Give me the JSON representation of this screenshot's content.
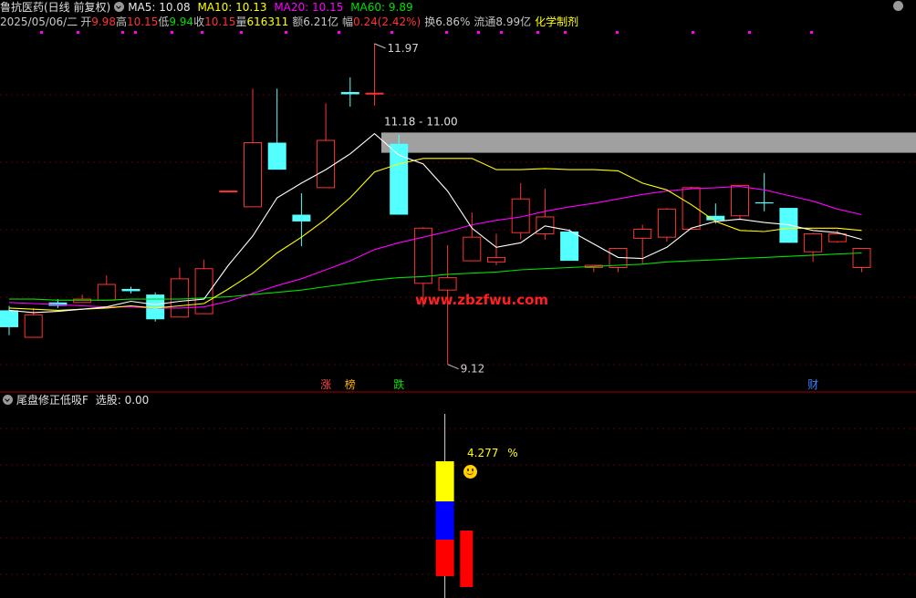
{
  "header": {
    "stock_name": "鲁抗医药(日线 前复权)",
    "ma5": "MA5: 10.08",
    "ma10": "MA10: 10.13",
    "ma20": "MA20: 10.15",
    "ma60": "MA60: 9.89"
  },
  "quote": {
    "date": "2025/05/06/二",
    "open_label": "开",
    "open": "9.98",
    "high_label": "高",
    "high": "10.15",
    "low_label": "低",
    "low": "9.94",
    "close_label": "收",
    "close": "10.15",
    "volume_label": "量",
    "volume": "616311",
    "amount_label": "额",
    "amount": "6.21亿",
    "change_label": "幅",
    "change": "0.24(2.42%)",
    "turnover_label": "换",
    "turnover": "6.86%",
    "float_label": "流通",
    "float_cap": "8.99亿",
    "sector": "化学制剂"
  },
  "indicator": {
    "title": "尾盘修正低吸F",
    "select_text": "选股: 0.00",
    "pct_value": "4.277",
    "pct_unit": "%",
    "smiley_icon": "smiley-face-icon"
  },
  "watermark": "www.zbzfwu.com",
  "colors": {
    "up": "#ff3232",
    "down": "#54ffff",
    "ma5": "#ffffff",
    "ma10": "#ffff00",
    "ma20": "#ff00ff",
    "ma60": "#00e000",
    "resistance": "#a0a0a0"
  },
  "chart_data": {
    "type": "candlestick",
    "price_annotations": {
      "high": "11.97",
      "low": "9.12",
      "zone": "11.18 - 11.00"
    },
    "event_markers": [
      {
        "label": "涨",
        "color": "#ff4040",
        "bar": 13
      },
      {
        "label": "榜",
        "color": "#ffb000",
        "bar": 14
      },
      {
        "label": "跌",
        "color": "#00e000",
        "bar": 16
      },
      {
        "label": "财",
        "color": "#4080ff",
        "bar": 33
      }
    ],
    "candles": [
      {
        "o": 9.6,
        "h": 9.64,
        "l": 9.38,
        "c": 9.45
      },
      {
        "o": 9.36,
        "h": 9.62,
        "l": 9.36,
        "c": 9.56
      },
      {
        "o": 9.67,
        "h": 9.7,
        "l": 9.62,
        "c": 9.64
      },
      {
        "o": 9.67,
        "h": 9.74,
        "l": 9.67,
        "c": 9.7
      },
      {
        "o": 9.69,
        "h": 9.91,
        "l": 9.69,
        "c": 9.83
      },
      {
        "o": 9.79,
        "h": 9.81,
        "l": 9.75,
        "c": 9.77
      },
      {
        "o": 9.74,
        "h": 9.76,
        "l": 9.5,
        "c": 9.52
      },
      {
        "o": 9.54,
        "h": 9.98,
        "l": 9.54,
        "c": 9.88
      },
      {
        "o": 9.57,
        "h": 10.05,
        "l": 9.57,
        "c": 9.97
      },
      {
        "o": 10.66,
        "h": 10.66,
        "l": 10.66,
        "c": 10.66
      },
      {
        "o": 10.52,
        "h": 11.57,
        "l": 10.52,
        "c": 11.09
      },
      {
        "o": 11.09,
        "h": 11.57,
        "l": 10.85,
        "c": 10.85
      },
      {
        "o": 10.45,
        "h": 10.64,
        "l": 10.17,
        "c": 10.39
      },
      {
        "o": 10.69,
        "h": 11.44,
        "l": 10.69,
        "c": 11.11
      },
      {
        "o": 11.54,
        "h": 11.67,
        "l": 11.41,
        "c": 11.52
      },
      {
        "o": 11.53,
        "h": 11.97,
        "l": 11.42,
        "c": 11.53
      },
      {
        "o": 11.08,
        "h": 11.16,
        "l": 10.45,
        "c": 10.45
      },
      {
        "o": 9.84,
        "h": 10.34,
        "l": 9.63,
        "c": 10.33
      },
      {
        "o": 9.78,
        "h": 10.18,
        "l": 9.12,
        "c": 9.89
      },
      {
        "o": 10.04,
        "h": 10.47,
        "l": 10.04,
        "c": 10.25
      },
      {
        "o": 10.03,
        "h": 10.28,
        "l": 10.0,
        "c": 10.07
      },
      {
        "o": 10.29,
        "h": 10.73,
        "l": 10.23,
        "c": 10.59
      },
      {
        "o": 10.28,
        "h": 10.68,
        "l": 10.23,
        "c": 10.43
      },
      {
        "o": 10.3,
        "h": 10.32,
        "l": 10.04,
        "c": 10.04
      },
      {
        "o": 9.98,
        "h": 10.0,
        "l": 9.94,
        "c": 10.0
      },
      {
        "o": 9.98,
        "h": 10.15,
        "l": 9.94,
        "c": 10.15
      },
      {
        "o": 10.24,
        "h": 10.36,
        "l": 10.01,
        "c": 10.32
      },
      {
        "o": 10.25,
        "h": 10.51,
        "l": 10.21,
        "c": 10.5
      },
      {
        "o": 10.32,
        "h": 10.7,
        "l": 10.32,
        "c": 10.69
      },
      {
        "o": 10.44,
        "h": 10.55,
        "l": 10.37,
        "c": 10.4
      },
      {
        "o": 10.44,
        "h": 10.7,
        "l": 10.4,
        "c": 10.71
      },
      {
        "o": 10.56,
        "h": 10.82,
        "l": 10.48,
        "c": 10.55
      },
      {
        "o": 10.51,
        "h": 10.51,
        "l": 10.2,
        "c": 10.2
      },
      {
        "o": 10.12,
        "h": 10.29,
        "l": 10.03,
        "c": 10.28
      },
      {
        "o": 10.21,
        "h": 10.31,
        "l": 10.2,
        "c": 10.28
      },
      {
        "o": 9.98,
        "h": 10.15,
        "l": 9.94,
        "c": 10.15
      }
    ],
    "ma5": [
      9.6,
      9.58,
      9.59,
      9.61,
      9.63,
      9.68,
      9.65,
      9.68,
      9.7,
      10.0,
      10.26,
      10.6,
      10.73,
      10.85,
      10.99,
      11.17,
      10.98,
      10.9,
      10.66,
      10.33,
      10.16,
      10.2,
      10.35,
      10.31,
      10.19,
      10.07,
      10.06,
      10.16,
      10.33,
      10.39,
      10.41,
      10.38,
      10.36,
      10.31,
      10.29,
      10.23
    ],
    "ma10": [
      9.62,
      9.61,
      9.6,
      9.61,
      9.62,
      9.64,
      9.62,
      9.64,
      9.66,
      9.79,
      9.93,
      10.11,
      10.25,
      10.41,
      10.6,
      10.83,
      10.9,
      10.95,
      10.95,
      10.95,
      10.85,
      10.85,
      10.86,
      10.85,
      10.85,
      10.84,
      10.73,
      10.67,
      10.54,
      10.39,
      10.31,
      10.3,
      10.33,
      10.33,
      10.33,
      10.31
    ],
    "ma20": [
      9.67,
      9.66,
      9.65,
      9.64,
      9.63,
      9.63,
      9.62,
      9.62,
      9.63,
      9.68,
      9.75,
      9.82,
      9.88,
      9.96,
      10.04,
      10.14,
      10.2,
      10.25,
      10.3,
      10.36,
      10.4,
      10.43,
      10.48,
      10.52,
      10.55,
      10.59,
      10.63,
      10.66,
      10.68,
      10.69,
      10.7,
      10.67,
      10.62,
      10.57,
      10.5,
      10.45
    ],
    "ma60": [
      9.7,
      9.7,
      9.69,
      9.69,
      9.69,
      9.7,
      9.7,
      9.7,
      9.71,
      9.72,
      9.74,
      9.76,
      9.78,
      9.81,
      9.84,
      9.87,
      9.89,
      9.9,
      9.92,
      9.93,
      9.94,
      9.96,
      9.97,
      9.98,
      9.99,
      10.0,
      10.01,
      10.03,
      10.04,
      10.05,
      10.06,
      10.07,
      10.08,
      10.09,
      10.1,
      10.11
    ],
    "y_range": [
      9.02,
      12.05
    ],
    "indicator_bars": [
      {
        "bar": 18,
        "segments": [
          {
            "from": 0,
            "to": 40,
            "color": "#ff0000"
          },
          {
            "from": 40,
            "to": 82,
            "color": "#0000ff"
          },
          {
            "from": 82,
            "to": 126,
            "color": "#ffff00"
          }
        ],
        "wick_top": 166
      },
      {
        "bar": 19,
        "segments": [
          {
            "from": 0,
            "to": 62,
            "color": "#ff0000"
          }
        ]
      }
    ]
  }
}
